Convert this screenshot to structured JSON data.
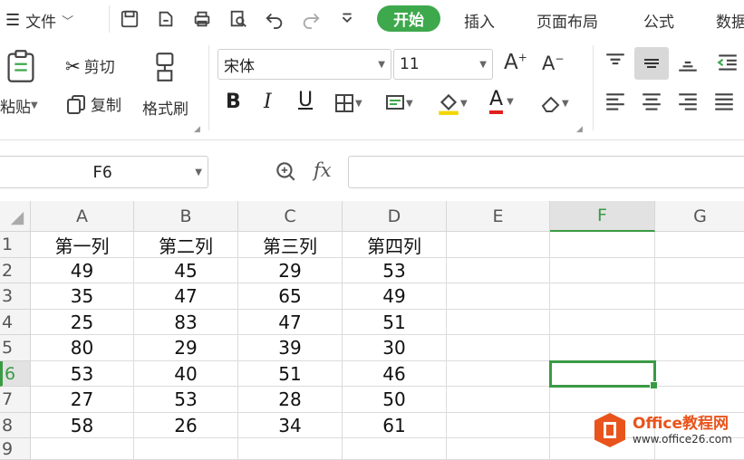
{
  "menu": {
    "hamburger_label": "文件",
    "tabs": [
      "开始",
      "插入",
      "页面布局",
      "公式",
      "数据"
    ]
  },
  "ribbon": {
    "paste_label": "粘贴",
    "cut_label": "剪切",
    "copy_label": "复制",
    "format_painter_label": "格式刷",
    "font_name": "宋体",
    "font_size": "11",
    "bold": "B",
    "italic": "I",
    "underline": "U"
  },
  "formula_bar": {
    "name_box": "F6",
    "fx_label": "fx",
    "formula": ""
  },
  "sheet": {
    "columns": [
      "A",
      "B",
      "C",
      "D",
      "E",
      "F",
      "G"
    ],
    "rows": [
      "1",
      "2",
      "3",
      "4",
      "5",
      "6",
      "7",
      "8",
      "9"
    ],
    "selected_cell": "F6",
    "cells": [
      [
        "第一列",
        "第二列",
        "第三列",
        "第四列"
      ],
      [
        "49",
        "45",
        "29",
        "53"
      ],
      [
        "35",
        "47",
        "65",
        "49"
      ],
      [
        "25",
        "83",
        "47",
        "51"
      ],
      [
        "80",
        "29",
        "39",
        "30"
      ],
      [
        "53",
        "40",
        "51",
        "46"
      ],
      [
        "27",
        "53",
        "28",
        "50"
      ],
      [
        "58",
        "26",
        "34",
        "61"
      ]
    ]
  },
  "watermark": {
    "brand": "Office教程网",
    "url": "www.office26.com"
  },
  "colors": {
    "accent_green": "#3ea84c",
    "selection_green": "#3a9a44",
    "watermark_orange": "#e8541c"
  }
}
